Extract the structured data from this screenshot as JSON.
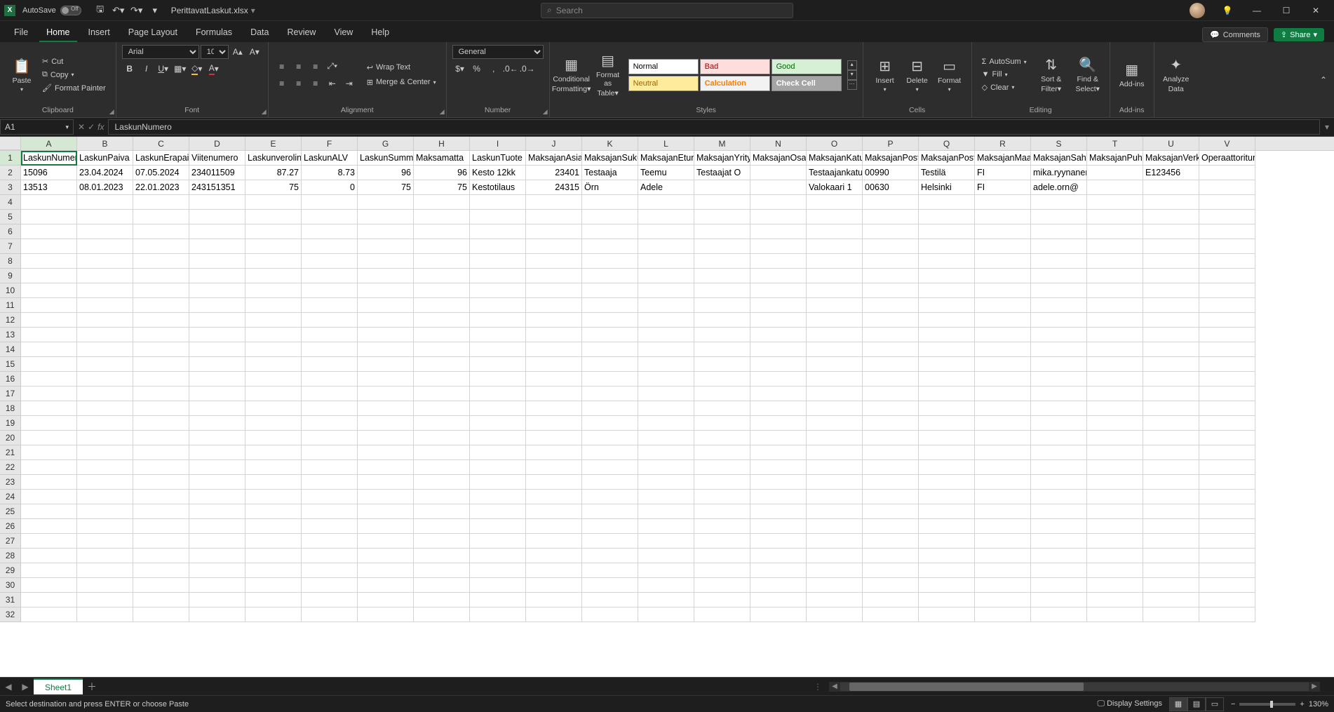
{
  "title_bar": {
    "autosave_label": "AutoSave",
    "autosave_state": "Off",
    "filename": "PerittavatLaskut.xlsx",
    "search_placeholder": "Search"
  },
  "tabs": {
    "file": "File",
    "home": "Home",
    "insert": "Insert",
    "page_layout": "Page Layout",
    "formulas": "Formulas",
    "data": "Data",
    "review": "Review",
    "view": "View",
    "help": "Help",
    "comments": "Comments",
    "share": "Share"
  },
  "ribbon": {
    "clipboard": {
      "paste": "Paste",
      "cut": "Cut",
      "copy": "Copy",
      "format_painter": "Format Painter",
      "label": "Clipboard"
    },
    "font": {
      "name": "Arial",
      "size": "10",
      "label": "Font"
    },
    "alignment": {
      "wrap": "Wrap Text",
      "merge": "Merge & Center",
      "label": "Alignment"
    },
    "number": {
      "format": "General",
      "label": "Number"
    },
    "styles": {
      "cond": "Conditional Formatting",
      "cond1": "Conditional",
      "cond2": "Formatting",
      "fat": "Format as Table",
      "fat1": "Format as",
      "fat2": "Table",
      "normal": "Normal",
      "bad": "Bad",
      "good": "Good",
      "neutral": "Neutral",
      "calc": "Calculation",
      "check": "Check Cell",
      "label": "Styles"
    },
    "cells": {
      "insert": "Insert",
      "delete": "Delete",
      "format": "Format",
      "label": "Cells"
    },
    "editing": {
      "autosum": "AutoSum",
      "fill": "Fill",
      "clear": "Clear",
      "sort": "Sort & Filter",
      "sort1": "Sort &",
      "sort2": "Filter",
      "find": "Find & Select",
      "find1": "Find &",
      "find2": "Select",
      "label": "Editing"
    },
    "addins": {
      "addins": "Add-ins",
      "label": "Add-ins"
    },
    "analyze": {
      "analyze1": "Analyze",
      "analyze2": "Data"
    }
  },
  "namebox": "A1",
  "formula": "LaskunNumero",
  "columns": [
    "A",
    "B",
    "C",
    "D",
    "E",
    "F",
    "G",
    "H",
    "I",
    "J",
    "K",
    "L",
    "M",
    "N",
    "O",
    "P",
    "Q",
    "R",
    "S",
    "T",
    "U",
    "V"
  ],
  "sheet": {
    "active_tab": "Sheet1",
    "rows": [
      [
        "LaskunNumero",
        "LaskunPaiva",
        "LaskunErapaiva",
        "Viitenumero",
        "LaskunverolinenSumma",
        "LaskunALV",
        "LaskunSumma",
        "Maksamatta",
        "LaskunTuote",
        "MaksajanAsiakasnumero",
        "MaksajanSukunimi",
        "MaksajanEtunimi",
        "MaksajanYritys",
        "MaksajanOsasto",
        "MaksajanKatuosoite",
        "MaksajanPostinumero",
        "MaksajanPostitoimipaikka",
        "MaksajanMaakoodi",
        "MaksajanSahkoposti",
        "MaksajanPuhelin",
        "MaksajanVerkkolaskuosoite",
        "Operaattoritunnus"
      ],
      [
        "15096",
        "23.04.2024",
        "07.05.2024",
        "234011509",
        "87.27",
        "8.73",
        "96",
        "96",
        "Kesto 12kk",
        "23401",
        "Testaaja",
        "Teemu",
        "Testaajat O",
        "",
        "Testaajankatu",
        "00990",
        "Testilä",
        "FI",
        "mika.ryynanen",
        "",
        "E123456",
        ""
      ],
      [
        "13513",
        "08.01.2023",
        "22.01.2023",
        "243151351",
        "75",
        "0",
        "75",
        "75",
        "Kestotilaus",
        "24315",
        "Örn",
        "Adele",
        "",
        "",
        "Valokaari 1",
        "00630",
        "Helsinki",
        "FI",
        "adele.orn@",
        "",
        "",
        ""
      ]
    ],
    "numeric_cols": [
      4,
      5,
      6,
      7,
      9
    ]
  },
  "status": {
    "message": "Select destination and press ENTER or choose Paste",
    "display_settings": "Display Settings",
    "zoom": "130%"
  }
}
